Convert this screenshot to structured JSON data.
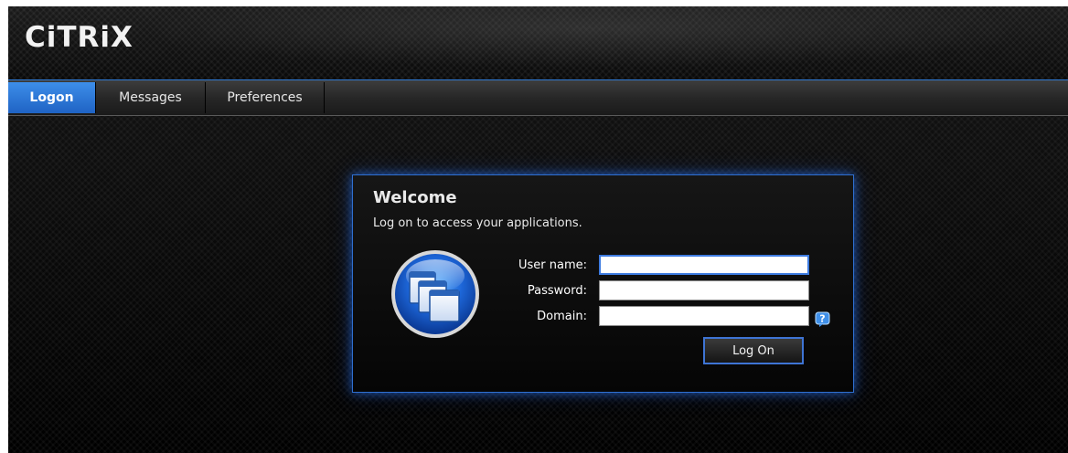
{
  "header": {
    "logo_text": "CiTRiX"
  },
  "nav": {
    "tabs": [
      {
        "label": "Logon",
        "active": true
      },
      {
        "label": "Messages",
        "active": false
      },
      {
        "label": "Preferences",
        "active": false
      }
    ]
  },
  "dialog": {
    "title": "Welcome",
    "subtitle": "Log on to access your applications.",
    "icon": "applications-icon",
    "fields": {
      "username": {
        "label": "User name:",
        "value": "",
        "focused": true
      },
      "password": {
        "label": "Password:",
        "value": ""
      },
      "domain": {
        "label": "Domain:",
        "value": ""
      }
    },
    "help_icon": "help-icon",
    "submit_label": "Log On"
  },
  "colors": {
    "accent": "#2f7bd6",
    "active_tab": "#2a73d6",
    "background": "#0d0d0d"
  }
}
